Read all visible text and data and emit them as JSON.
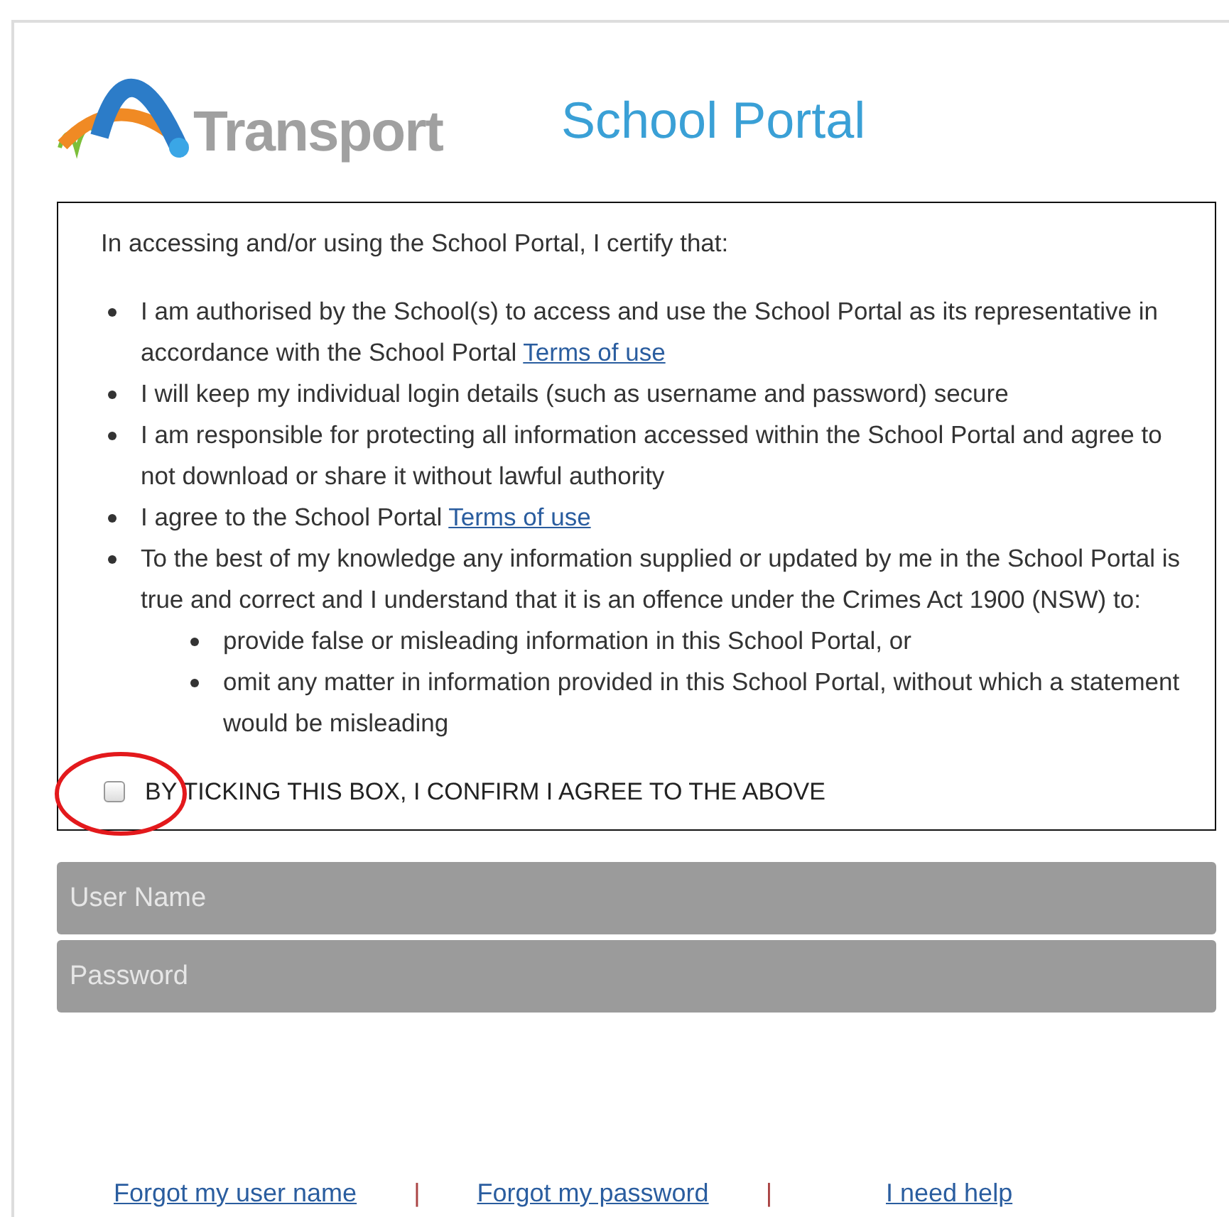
{
  "header": {
    "logo_text": "Transport",
    "title": "School Portal"
  },
  "declaration": {
    "intro": "In accessing and/or using the School Portal, I certify that:",
    "items": [
      {
        "text": "I am authorised by the School(s) to access and use the School Portal as its representative in accordance with the School Portal ",
        "link": "Terms of use"
      },
      {
        "text": "I will keep my individual login details (such as username and password) secure"
      },
      {
        "text": "I am responsible for protecting all information accessed within the School Portal and agree to not download or share it without lawful authority"
      },
      {
        "text": "I agree to the School Portal ",
        "link": "Terms of use"
      },
      {
        "text": "To the best of my knowledge any information supplied or updated by me in the School Portal is true and correct and I understand that it is an offence under the Crimes Act 1900 (NSW) to:",
        "children": [
          {
            "text": "provide false or misleading information in this School Portal, or"
          },
          {
            "text": "omit any matter in information provided in this School Portal, without which a statement would be misleading"
          }
        ]
      }
    ],
    "agree": {
      "label": "BY TICKING THIS BOX, I CONFIRM I AGREE TO THE ABOVE",
      "checked": false,
      "circled": true
    }
  },
  "fields": [
    {
      "placeholder": "User Name",
      "disabled": true
    },
    {
      "placeholder": "Password",
      "disabled": true
    }
  ],
  "links": [
    "Forgot my user name",
    "Forgot my password",
    "I need help"
  ],
  "separators": [
    "|",
    "|"
  ]
}
